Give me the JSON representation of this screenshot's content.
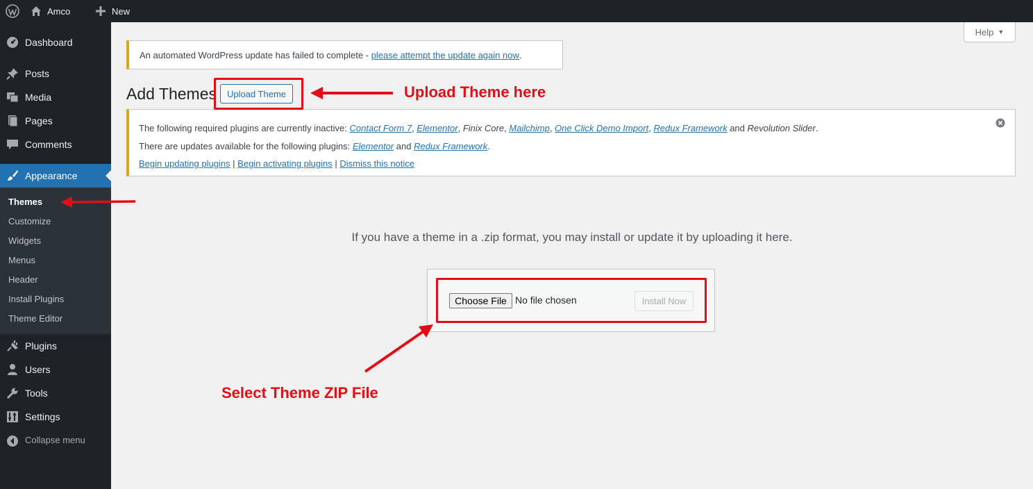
{
  "adminbar": {
    "site_name": "Amco",
    "new_label": "New"
  },
  "sidebar": {
    "items": [
      {
        "label": "Dashboard",
        "icon": "dashboard-icon"
      },
      {
        "label": "Posts",
        "icon": "pushpin-icon"
      },
      {
        "label": "Media",
        "icon": "media-icon"
      },
      {
        "label": "Pages",
        "icon": "pages-icon"
      },
      {
        "label": "Comments",
        "icon": "comment-icon"
      },
      {
        "label": "Appearance",
        "icon": "paintbrush-icon"
      },
      {
        "label": "Plugins",
        "icon": "plug-icon"
      },
      {
        "label": "Users",
        "icon": "user-icon"
      },
      {
        "label": "Tools",
        "icon": "wrench-icon"
      },
      {
        "label": "Settings",
        "icon": "settings-icon"
      }
    ],
    "submenu": [
      "Themes",
      "Customize",
      "Widgets",
      "Menus",
      "Header",
      "Install Plugins",
      "Theme Editor"
    ],
    "collapse_label": "Collapse menu"
  },
  "help": {
    "label": "Help"
  },
  "update_notice": {
    "text": "An automated WordPress update has failed to complete - ",
    "link": "please attempt the update again now",
    "suffix": "."
  },
  "page": {
    "title": "Add Themes",
    "upload_button": "Upload Theme"
  },
  "plugins_notice": {
    "line1_prefix": "The following required plugins are currently inactive: ",
    "inactive": [
      "Contact Form 7",
      "Elementor",
      "Finix Core",
      "Mailchimp",
      "One Click Demo Import",
      "Redux Framework",
      "Revolution Slider"
    ],
    "line1_and": "and",
    "line2_prefix": "There are updates available for the following plugins: ",
    "updates": [
      "Elementor",
      "Redux Framework"
    ],
    "line2_and": "and",
    "actions": [
      "Begin updating plugins",
      "Begin activating plugins",
      "Dismiss this notice"
    ]
  },
  "upload": {
    "description": "If you have a theme in a .zip format, you may install or update it by uploading it here.",
    "choose_file": "Choose File",
    "no_file": "No file chosen",
    "install": "Install Now"
  },
  "annotations": {
    "upload_theme": "Upload Theme here",
    "select_zip": "Select  Theme  ZIP File"
  },
  "colors": {
    "accent": "#2271b1",
    "annotation": "#e30d16",
    "sidebar": "#1d2327",
    "warning": "#dba617"
  }
}
